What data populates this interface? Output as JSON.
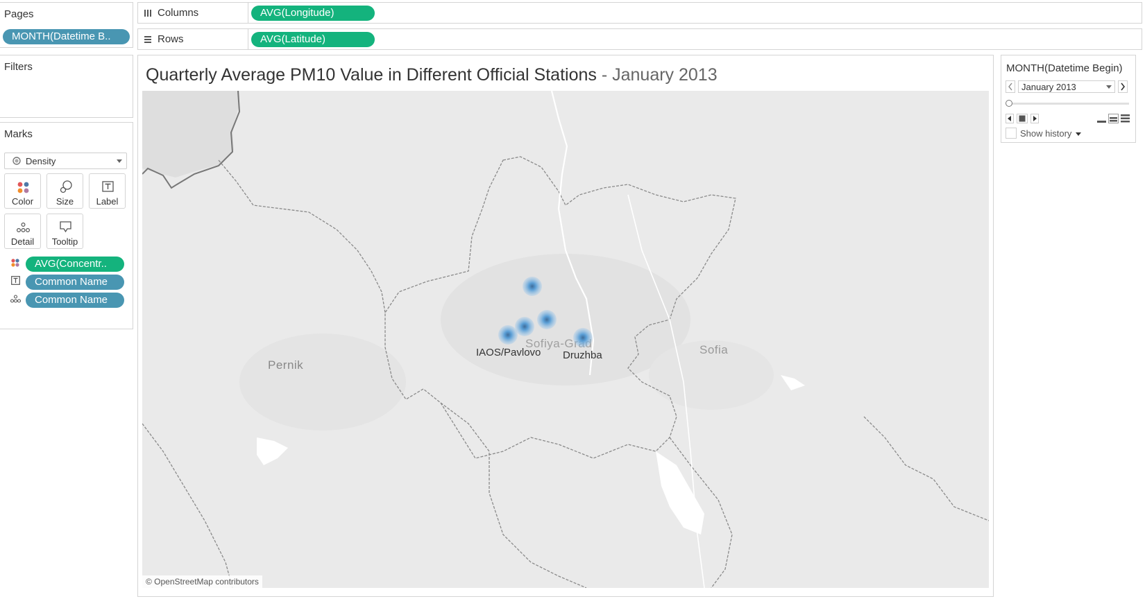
{
  "pages": {
    "title": "Pages",
    "pill": "MONTH(Datetime B.."
  },
  "columns": {
    "label": "Columns",
    "pill": "AVG(Longitude)"
  },
  "rows": {
    "label": "Rows",
    "pill": "AVG(Latitude)"
  },
  "filters": {
    "title": "Filters"
  },
  "marks": {
    "title": "Marks",
    "type": "Density",
    "buttons": {
      "color": "Color",
      "size": "Size",
      "label": "Label",
      "detail": "Detail",
      "tooltip": "Tooltip"
    },
    "fields": [
      "AVG(Concentr..",
      "Common Name",
      "Common Name"
    ]
  },
  "sheet": {
    "title": "Quarterly Average PM10 Value in Different Official Stations",
    "title_sep": " - ",
    "subtitle": "January 2013"
  },
  "map": {
    "place_labels": {
      "pernik": "Pernik",
      "sofiya_grad": "Sofiya-Grad",
      "sofia": "Sofia"
    },
    "station_labels": {
      "iaos": "IAOS/Pavlovo",
      "druzhba": "Druzhba"
    },
    "attribution": "© OpenStreetMap contributors",
    "colors": {
      "land": "#eaeaea",
      "urban": "#e2e2e2",
      "water": "#ffffff",
      "border": "#888888",
      "mark": "#5b9fd6"
    }
  },
  "page_control": {
    "title": "MONTH(Datetime Begin)",
    "value": "January 2013",
    "show_history": "Show history"
  }
}
